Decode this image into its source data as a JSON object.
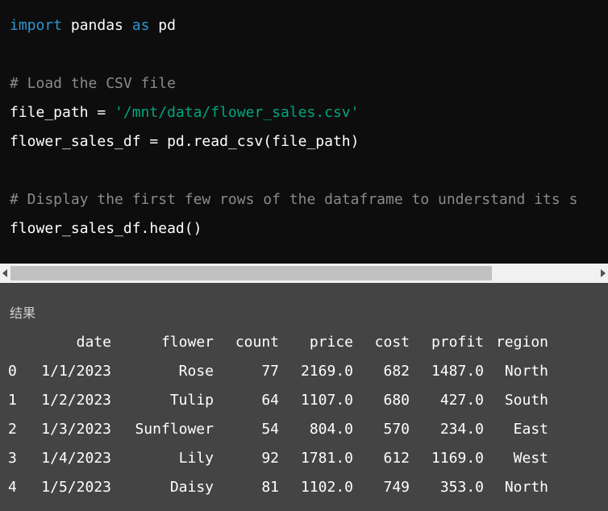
{
  "code": {
    "line1": {
      "kw_import": "import",
      "module": " pandas ",
      "kw_as": "as",
      "alias": " pd"
    },
    "line2": {
      "comment": "# Load the CSV file"
    },
    "line3": {
      "var": "file_path = ",
      "path": "'/mnt/data/flower_sales.csv'"
    },
    "line4": {
      "text": "flower_sales_df = pd.read_csv(file_path)"
    },
    "line5": {
      "comment": "# Display the first few rows of the dataframe to understand its s"
    },
    "line6": {
      "text": "flower_sales_df.head()"
    }
  },
  "scrollbar": {
    "thumb_fraction": 0.82
  },
  "result": {
    "label": "结果",
    "columns": [
      "date",
      "flower",
      "count",
      "price",
      "cost",
      "profit",
      "region"
    ],
    "rows": [
      {
        "index": "0",
        "date": "1/1/2023",
        "flower": "Rose",
        "count": "77",
        "price": "2169.0",
        "cost": "682",
        "profit": "1487.0",
        "region": "North"
      },
      {
        "index": "1",
        "date": "1/2/2023",
        "flower": "Tulip",
        "count": "64",
        "price": "1107.0",
        "cost": "680",
        "profit": "427.0",
        "region": "South"
      },
      {
        "index": "2",
        "date": "1/3/2023",
        "flower": "Sunflower",
        "count": "54",
        "price": "804.0",
        "cost": "570",
        "profit": "234.0",
        "region": "East"
      },
      {
        "index": "3",
        "date": "1/4/2023",
        "flower": "Lily",
        "count": "92",
        "price": "1781.0",
        "cost": "612",
        "profit": "1169.0",
        "region": "West"
      },
      {
        "index": "4",
        "date": "1/5/2023",
        "flower": "Daisy",
        "count": "81",
        "price": "1102.0",
        "cost": "749",
        "profit": "353.0",
        "region": "North"
      }
    ]
  },
  "colors": {
    "code_bg": "#0d0d0d",
    "keyword": "#2e95d3",
    "string": "#00a67d",
    "comment": "#8a8a8a",
    "result_bg": "#444444"
  }
}
